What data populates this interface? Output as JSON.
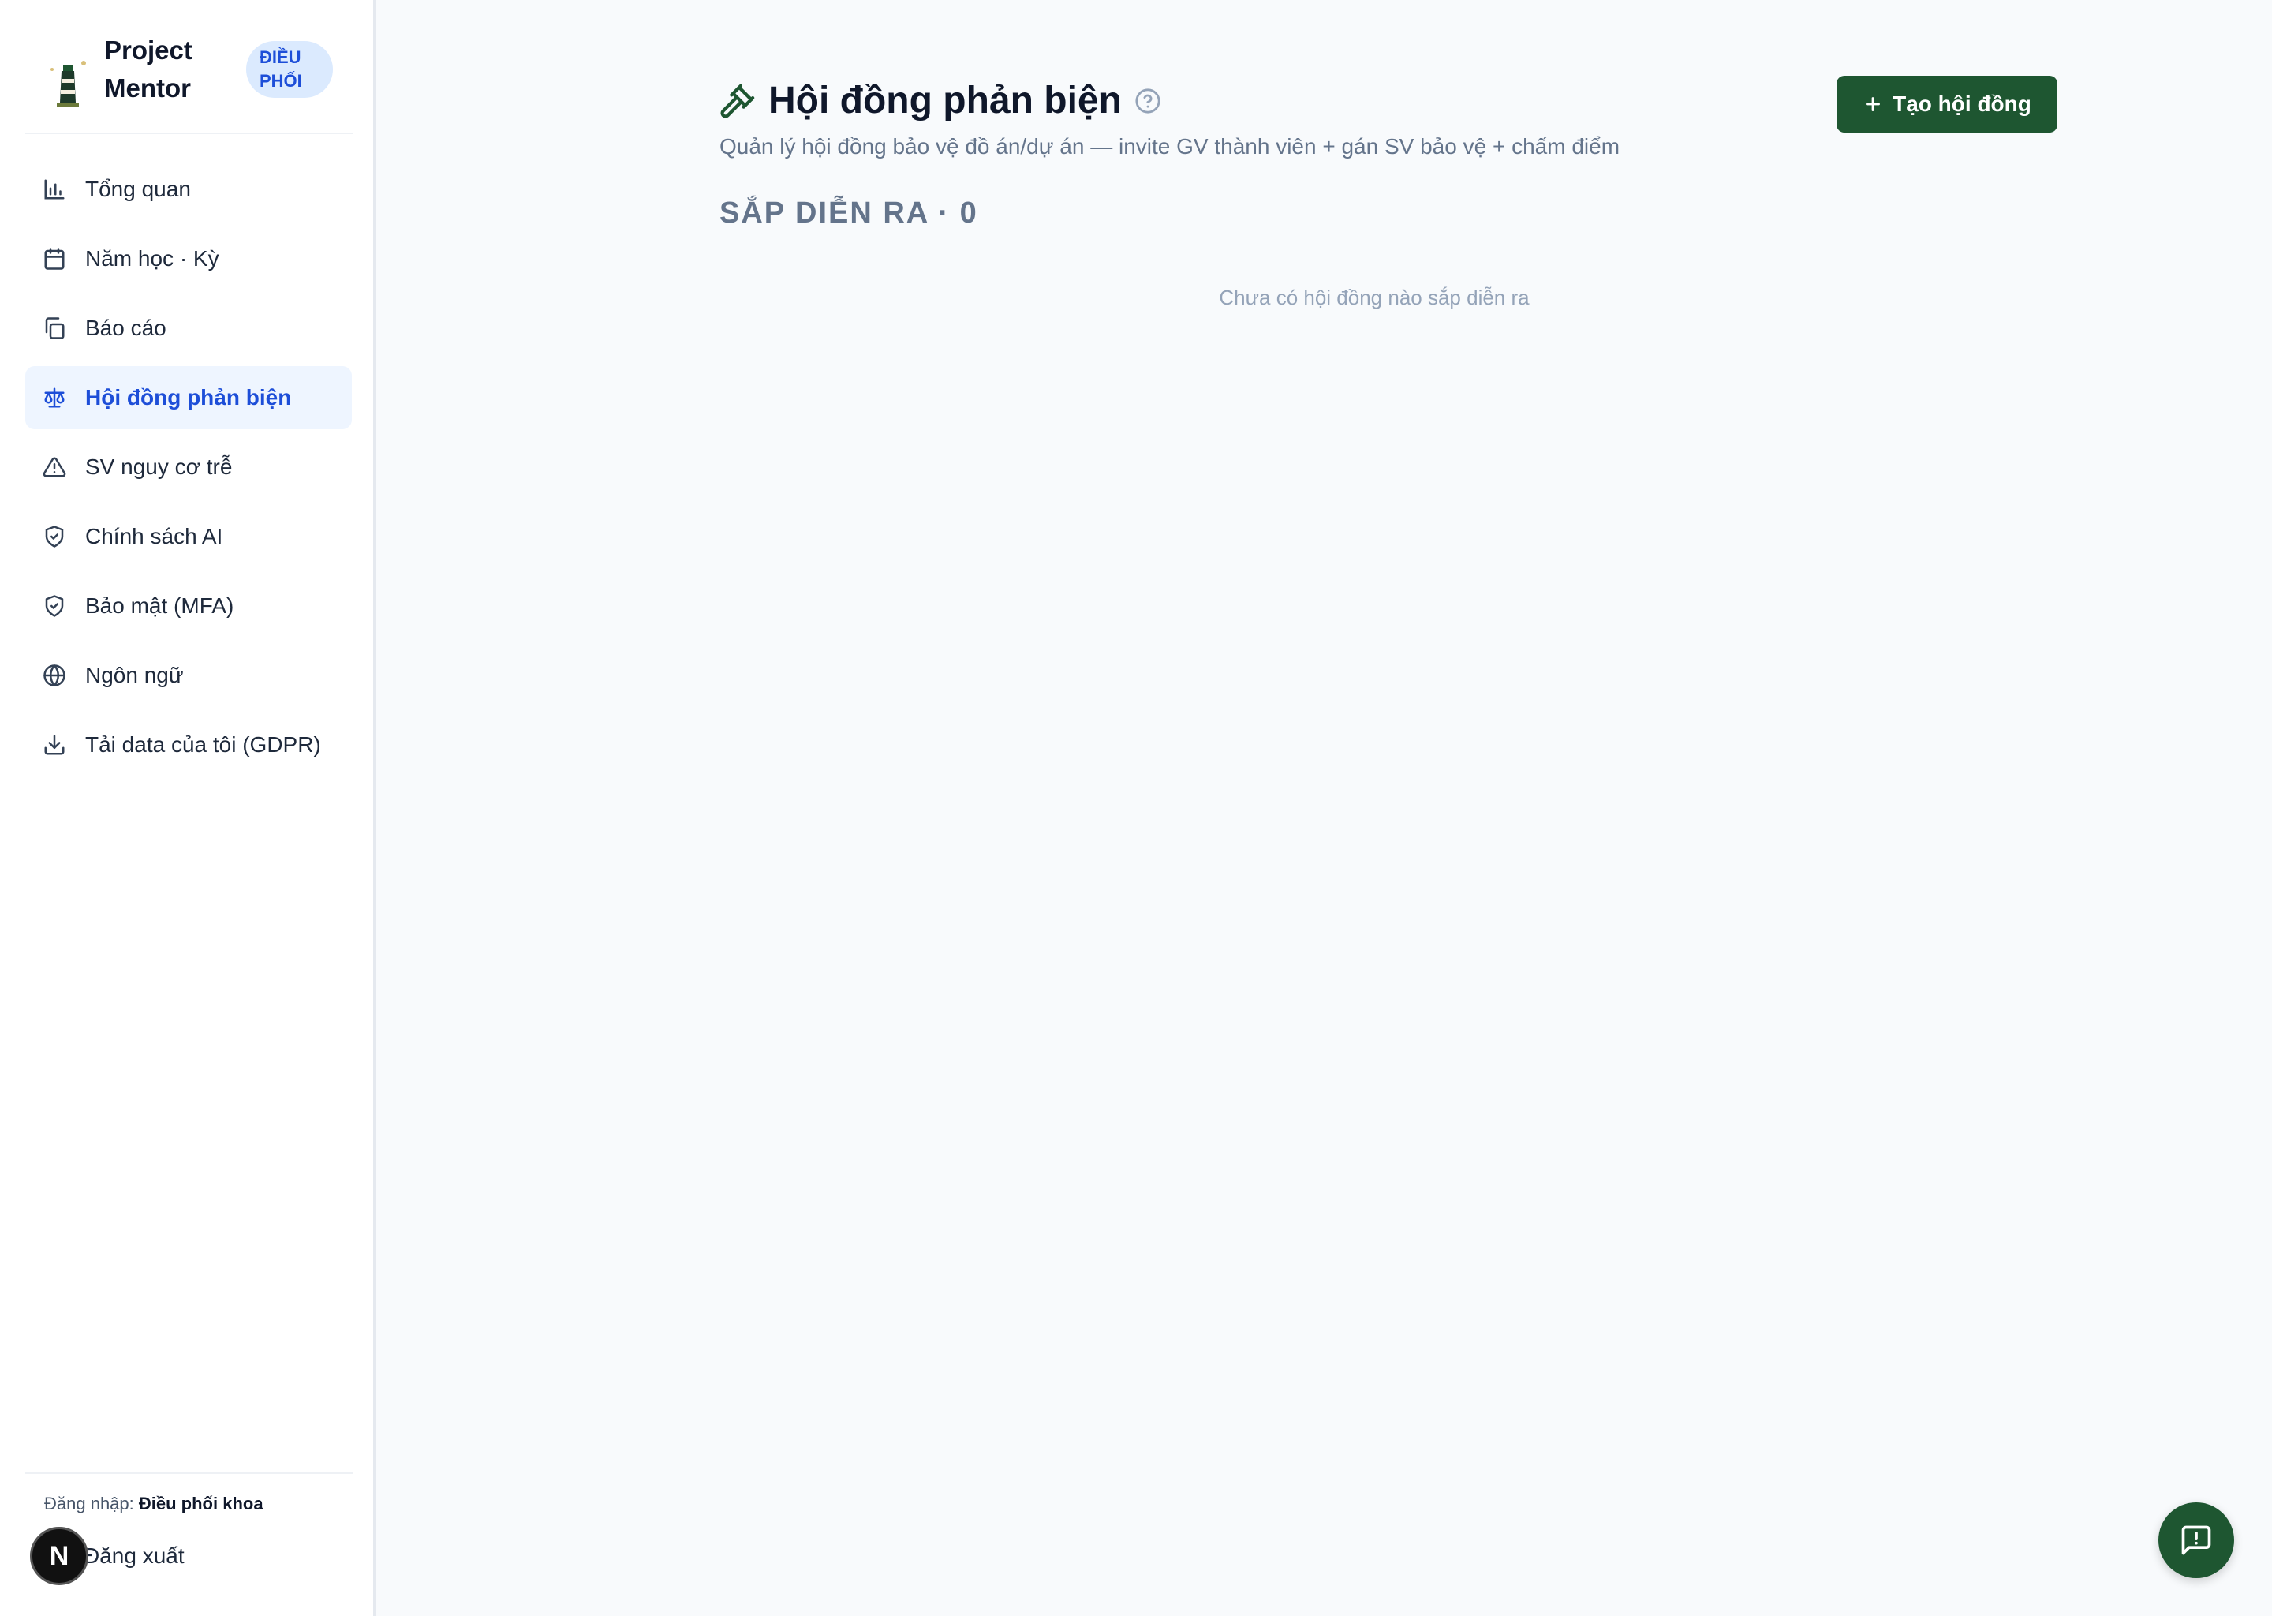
{
  "app": {
    "name": "Project Mentor",
    "name_line1": "Project",
    "name_line2": "Mentor",
    "role_badge_line1": "ĐIỀU",
    "role_badge_line2": "PHỐI"
  },
  "sidebar": {
    "items": [
      {
        "label": "Tổng quan",
        "icon": "bar-chart-icon",
        "active": false
      },
      {
        "label": "Năm học · Kỳ",
        "icon": "calendar-icon",
        "active": false
      },
      {
        "label": "Báo cáo",
        "icon": "copy-document-icon",
        "active": false
      },
      {
        "label": "Hội đồng phản biện",
        "icon": "scale-icon",
        "active": true
      },
      {
        "label": "SV nguy cơ trễ",
        "icon": "warning-triangle-icon",
        "active": false
      },
      {
        "label": "Chính sách AI",
        "icon": "shield-check-icon",
        "active": false
      },
      {
        "label": "Bảo mật (MFA)",
        "icon": "shield-check-icon",
        "active": false
      },
      {
        "label": "Ngôn ngữ",
        "icon": "globe-icon",
        "active": false
      },
      {
        "label": "Tải data của tôi (GDPR)",
        "icon": "download-icon",
        "active": false
      }
    ],
    "login_prefix": "Đăng nhập:",
    "login_user": "Điều phối khoa",
    "logout_label": "Đăng xuất",
    "avatar_letter": "N"
  },
  "main": {
    "title": "Hội đồng phản biện",
    "subtitle": "Quản lý hội đồng bảo vệ đồ án/dự án — invite GV thành viên + gán SV bảo vệ + chấm điểm",
    "create_button_label": "Tạo hội đồng",
    "section_heading": "SẮP DIỄN RA · 0",
    "empty_message": "Chưa có hội đồng nào sắp diễn ra"
  },
  "colors": {
    "brand_green": "#1e5631",
    "active_blue": "#1d4ed8",
    "active_bg": "#eef5ff",
    "badge_bg": "#dbeafe",
    "page_bg": "#f8fafc"
  }
}
